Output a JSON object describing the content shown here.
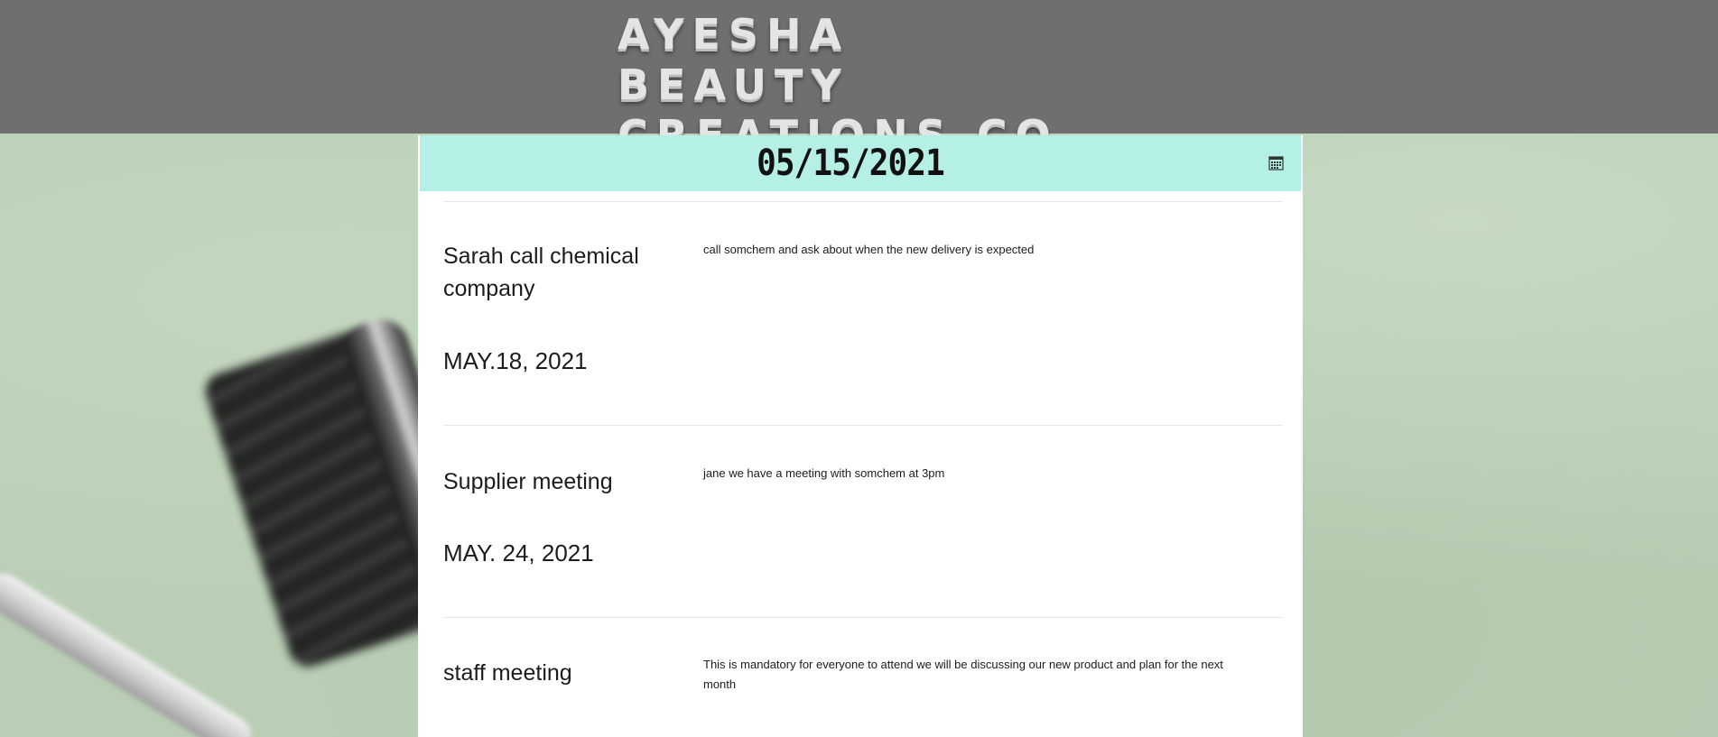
{
  "header": {
    "brand_line1": "AYESHA BEAUTY",
    "brand_line2": "CREATIONS CO."
  },
  "date_picker": {
    "selected_date": "05/15/2021",
    "icon": "calendar-icon",
    "background_color": "#b4f0e6"
  },
  "events": [
    {
      "title": "Sarah call chemical company",
      "date": "MAY.18, 2021",
      "description": "call somchem and ask about when the new delivery is expected"
    },
    {
      "title": "Supplier meeting",
      "date": "MAY. 24, 2021",
      "description": "jane we have a meeting with somchem at 3pm"
    },
    {
      "title": "staff meeting",
      "description": "This is mandatory for everyone to attend we will be discussing our new product and plan for the next month"
    }
  ],
  "colors": {
    "header_background": "#6f6f6f",
    "page_background": "#b9ceb5",
    "card_background": "#ffffff"
  }
}
